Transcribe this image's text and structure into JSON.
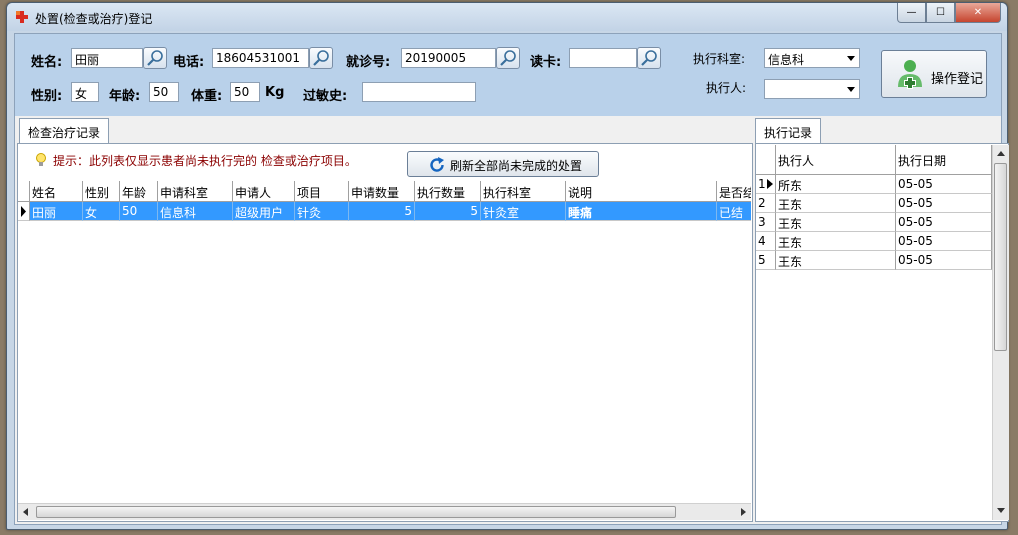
{
  "window": {
    "title": "处置(检查或治疗)登记",
    "buttons": {
      "minimize": "—",
      "maximize": "☐",
      "close": "✕"
    }
  },
  "form": {
    "name_label": "姓名:",
    "name_value": "田丽",
    "phone_label": "电话:",
    "phone_value": "18604531001",
    "visit_label": "就诊号:",
    "visit_value": "20190005",
    "card_label": "读卡:",
    "card_value": "",
    "gender_label": "性别:",
    "gender_value": "女",
    "age_label": "年龄:",
    "age_value": "50",
    "weight_label": "体重:",
    "weight_value": "50",
    "weight_unit": "Kg",
    "allergy_label": "过敏史:",
    "allergy_value": "",
    "exec_dept_label": "执行科室:",
    "exec_dept_value": "信息科",
    "executor_label": "执行人:",
    "executor_value": "",
    "register_button": "操作登记"
  },
  "left_tab": {
    "label": "检查治疗记录",
    "hint": "提示：此列表仅显示患者尚未执行完的 检查或治疗项目。",
    "refresh_button": "刷新全部尚未完成的处置",
    "columns": [
      "姓名",
      "性别",
      "年龄",
      "申请科室",
      "申请人",
      "项目",
      "申请数量",
      "执行数量",
      "执行科室",
      "说明",
      "是否结"
    ],
    "rows": [
      [
        "田丽",
        "女",
        "50",
        "信息科",
        "超级用户",
        "针灸",
        "5",
        "5",
        "针灸室",
        "睡痛",
        "已结"
      ]
    ]
  },
  "right_tab": {
    "label": "执行记录",
    "columns": [
      "执行人",
      "执行日期"
    ],
    "rows": [
      {
        "num": "1",
        "executor": "所东",
        "date": "05-05"
      },
      {
        "num": "2",
        "executor": "王东",
        "date": "05-05"
      },
      {
        "num": "3",
        "executor": "王东",
        "date": "05-05"
      },
      {
        "num": "4",
        "executor": "王东",
        "date": "05-05"
      },
      {
        "num": "5",
        "executor": "王东",
        "date": "05-05"
      }
    ]
  },
  "colors": {
    "panel_bg": "#b9d1ea",
    "selection": "#3399ff",
    "hint_text": "#8b0000"
  }
}
